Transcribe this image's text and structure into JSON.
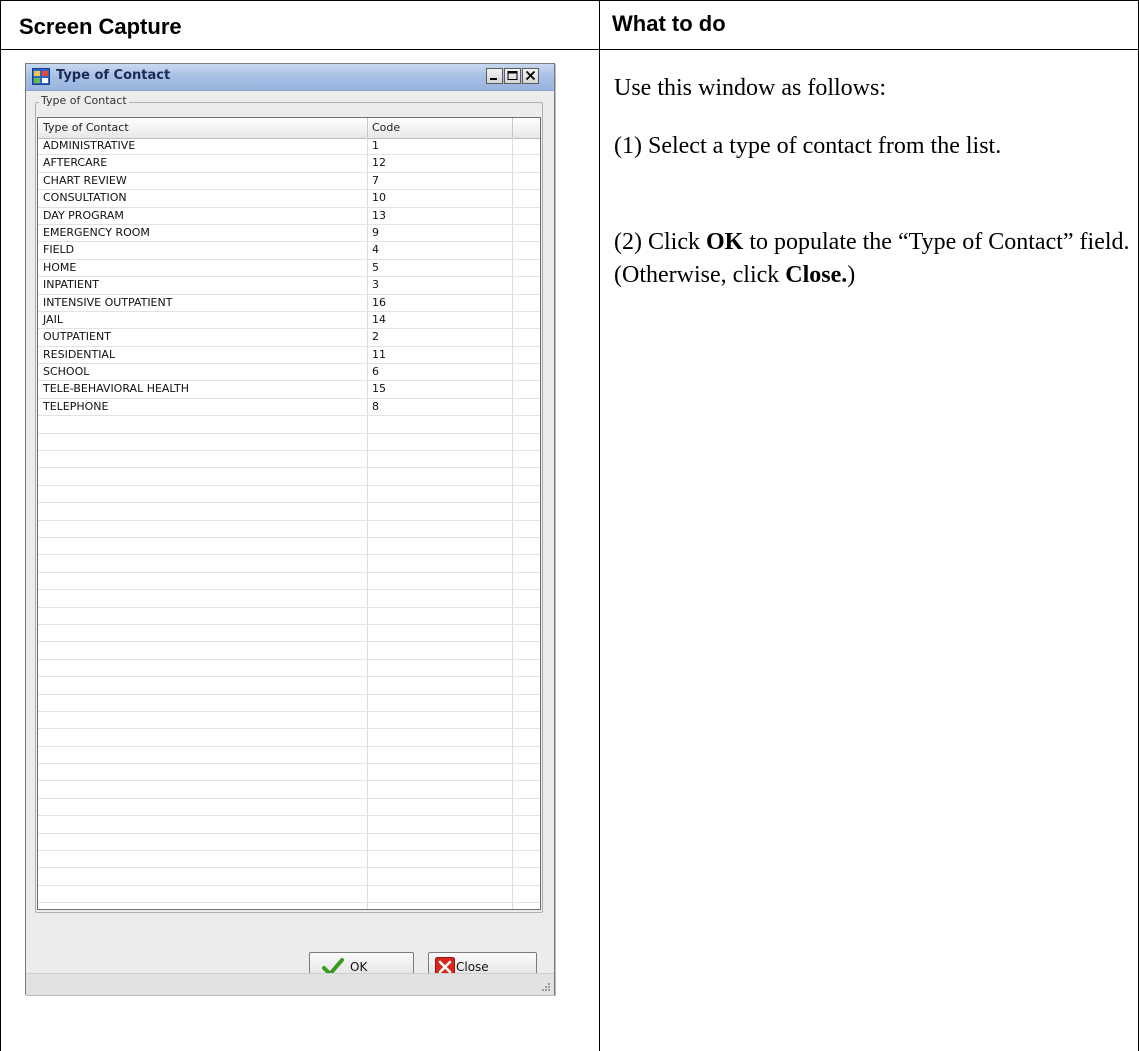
{
  "document": {
    "col1_header": "Screen Capture",
    "col2_header": "What to do",
    "instructions": {
      "intro": "Use this window as follows:",
      "step1": "(1) Select a type of contact from the list.",
      "step2_prefix": "(2) Click ",
      "step2_ok": "OK",
      "step2_middle": " to populate the “Type of Contact” field. (Otherwise, click ",
      "step2_close": "Close.",
      "step2_suffix": ")"
    }
  },
  "window": {
    "title": "Type of Contact",
    "group_label": "Type of Contact",
    "columns": [
      "Type of Contact",
      "Code"
    ],
    "rows": [
      {
        "type": "ADMINISTRATIVE",
        "code": "1"
      },
      {
        "type": "AFTERCARE",
        "code": "12"
      },
      {
        "type": "CHART REVIEW",
        "code": "7"
      },
      {
        "type": "CONSULTATION",
        "code": "10"
      },
      {
        "type": "DAY PROGRAM",
        "code": "13"
      },
      {
        "type": "EMERGENCY ROOM",
        "code": "9"
      },
      {
        "type": "FIELD",
        "code": "4"
      },
      {
        "type": "HOME",
        "code": "5"
      },
      {
        "type": "INPATIENT",
        "code": "3"
      },
      {
        "type": "INTENSIVE OUTPATIENT",
        "code": "16"
      },
      {
        "type": "JAIL",
        "code": "14"
      },
      {
        "type": "OUTPATIENT",
        "code": "2"
      },
      {
        "type": "RESIDENTIAL",
        "code": "11"
      },
      {
        "type": "SCHOOL",
        "code": "6"
      },
      {
        "type": "TELE-BEHAVIORAL HEALTH",
        "code": "15"
      },
      {
        "type": "TELEPHONE",
        "code": "8"
      }
    ],
    "ok_label": "OK",
    "close_label": "Close",
    "icons": {
      "app": "window-app-icon",
      "minimize": "minimize-icon",
      "maximize": "maximize-icon",
      "close": "close-icon",
      "ok": "checkmark-icon",
      "close_button": "red-x-icon"
    },
    "colors": {
      "titlebar": "#a9c1e6",
      "ok_check": "#3a9a1f",
      "close_x": "#d8261c"
    }
  }
}
